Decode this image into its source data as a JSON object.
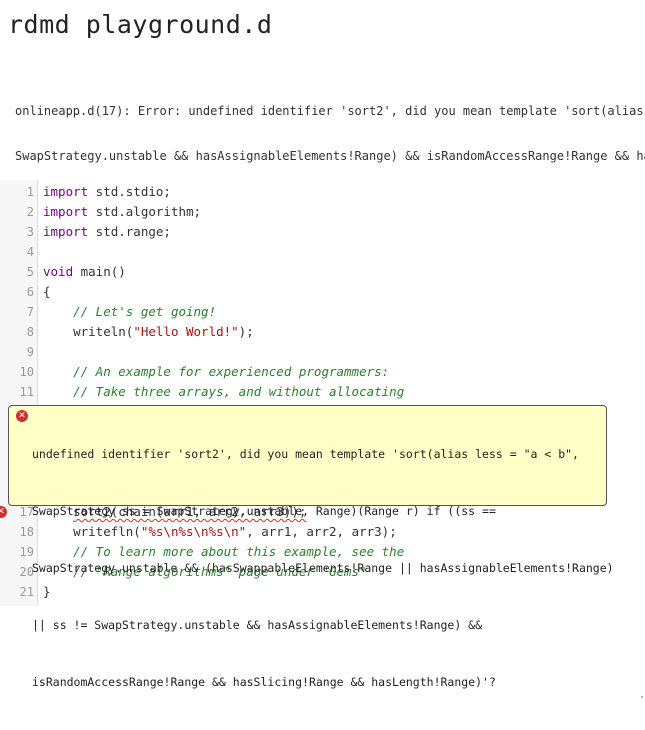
{
  "page": {
    "title": "rdmd playground.d"
  },
  "error_output": {
    "lines": [
      "onlineapp.d(17): Error: undefined identifier 'sort2', did you mean template 'sort(alias le",
      "SwapStrategy.unstable && hasAssignableElements!Range) && isRandomAccessRange!Range && hasS"
    ]
  },
  "editor": {
    "lines": [
      {
        "n": "1",
        "tokens": [
          {
            "t": "import",
            "c": "kw"
          },
          {
            "t": " std.stdio;"
          }
        ]
      },
      {
        "n": "2",
        "tokens": [
          {
            "t": "import",
            "c": "kw"
          },
          {
            "t": " std.algorithm;"
          }
        ]
      },
      {
        "n": "3",
        "tokens": [
          {
            "t": "import",
            "c": "kw"
          },
          {
            "t": " std.range;"
          }
        ]
      },
      {
        "n": "4",
        "tokens": []
      },
      {
        "n": "5",
        "tokens": [
          {
            "t": "void",
            "c": "kw"
          },
          {
            "t": " main()"
          }
        ]
      },
      {
        "n": "6",
        "tokens": [
          {
            "t": "{"
          }
        ]
      },
      {
        "n": "7",
        "tokens": [
          {
            "t": "    "
          },
          {
            "t": "// Let's get going!",
            "c": "cmt"
          }
        ]
      },
      {
        "n": "8",
        "tokens": [
          {
            "t": "    writeln("
          },
          {
            "t": "\"Hello World!\"",
            "c": "str"
          },
          {
            "t": ");"
          }
        ]
      },
      {
        "n": "9",
        "tokens": []
      },
      {
        "n": "10",
        "tokens": [
          {
            "t": "    "
          },
          {
            "t": "// An example for experienced programmers:",
            "c": "cmt"
          }
        ]
      },
      {
        "n": "11",
        "tokens": [
          {
            "t": "    "
          },
          {
            "t": "// Take three arrays, and without allocating",
            "c": "cmt"
          }
        ]
      },
      {
        "n": "17",
        "error": true,
        "tokens": [
          {
            "t": "    "
          },
          {
            "t": "sort2(chain(arr1, arr2, arr3));",
            "c": "squiggle"
          }
        ]
      },
      {
        "n": "18",
        "tokens": [
          {
            "t": "    writefln("
          },
          {
            "t": "\"%s\\n%s\\n%s\\n\"",
            "c": "str"
          },
          {
            "t": ", arr1, arr2, arr3);"
          }
        ]
      },
      {
        "n": "19",
        "tokens": [
          {
            "t": "    "
          },
          {
            "t": "// To learn more about this example, see the",
            "c": "cmt"
          }
        ]
      },
      {
        "n": "20",
        "tokens": [
          {
            "t": "    "
          },
          {
            "t": "// \"Range algorithms\" page under \"Gems\"",
            "c": "cmt"
          }
        ]
      },
      {
        "n": "21",
        "tokens": [
          {
            "t": "}"
          }
        ]
      }
    ]
  },
  "tooltip": {
    "icon": "error-icon",
    "lines": [
      "undefined identifier 'sort2', did you mean template 'sort(alias less = \"a < b\",",
      "SwapStrategy ss = SwapStrategy.unstable, Range)(Range r) if ((ss ==",
      "SwapStrategy.unstable && (hasSwappableElements!Range || hasAssignableElements!Range)",
      "|| ss != SwapStrategy.unstable && hasAssignableElements!Range) &&",
      "isRandomAccessRange!Range && hasSlicing!Range && hasLength!Range)'?"
    ]
  },
  "colors": {
    "error": "#d32f2f",
    "tooltip_bg": "#ffffc8",
    "keyword": "#770088",
    "string": "#aa1111",
    "comment": "#2e7d32"
  }
}
